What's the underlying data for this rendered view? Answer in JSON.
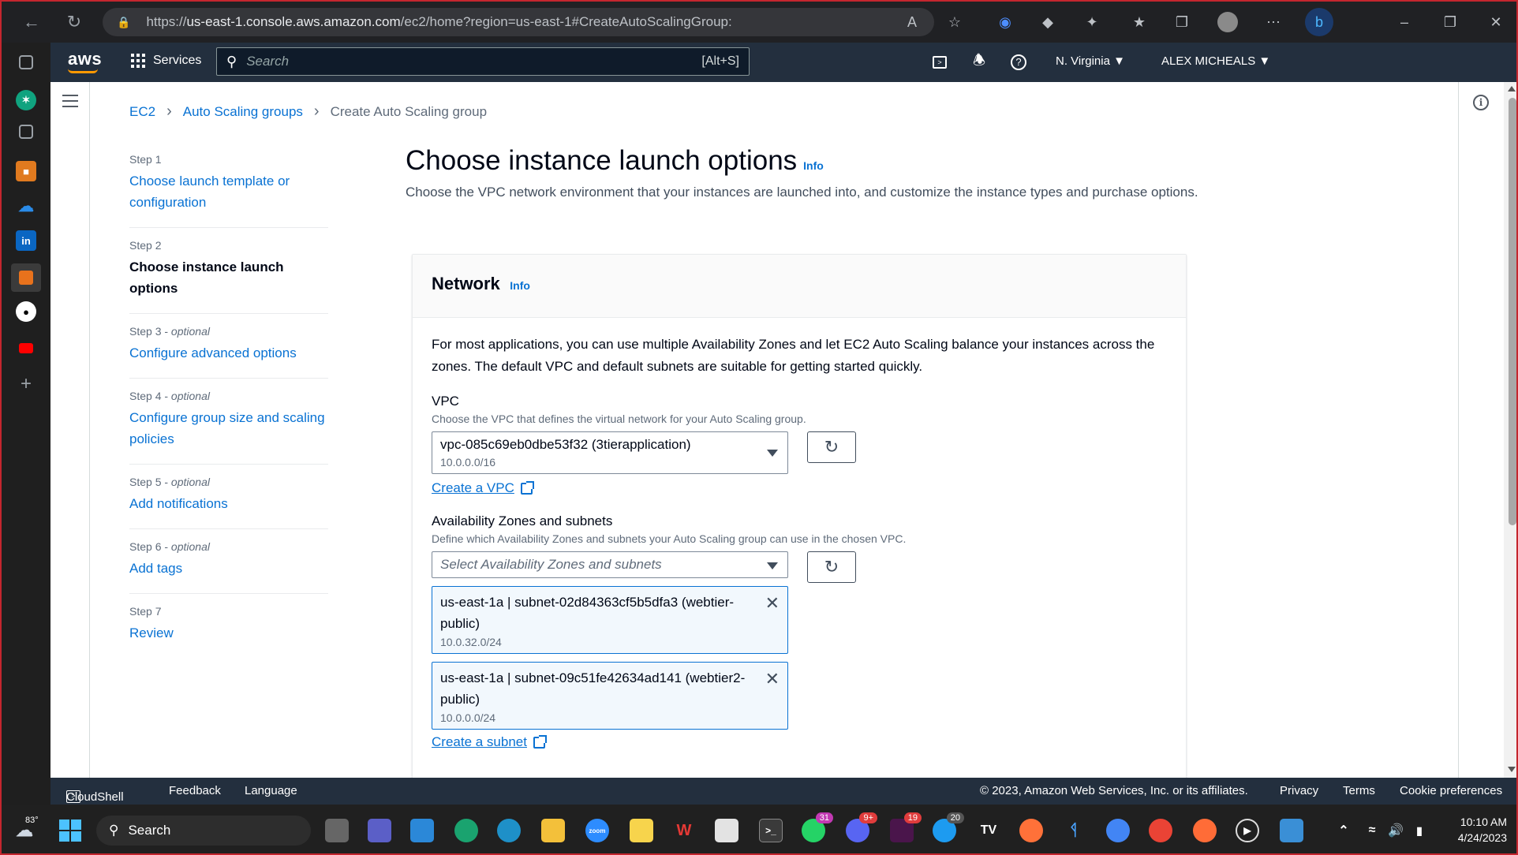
{
  "browser": {
    "url_prefix": "https://",
    "url_host": "us-east-1.console.aws.amazon.com",
    "url_rest": "/ec2/home?region=us-east-1#CreateAutoScalingGroup:"
  },
  "aws_nav": {
    "logo": "aws",
    "services": "Services",
    "search_placeholder": "Search",
    "search_shortcut": "[Alt+S]",
    "region": "N. Virginia",
    "user": "ALEX MICHEALS"
  },
  "breadcrumb": {
    "ec2": "EC2",
    "asg": "Auto Scaling groups",
    "current": "Create Auto Scaling group"
  },
  "steps": [
    {
      "num": "Step 1",
      "optional": "",
      "label": "Choose launch template or configuration"
    },
    {
      "num": "Step 2",
      "optional": "",
      "label": "Choose instance launch options"
    },
    {
      "num": "Step 3 - ",
      "optional": "optional",
      "label": "Configure advanced options"
    },
    {
      "num": "Step 4 - ",
      "optional": "optional",
      "label": "Configure group size and scaling policies"
    },
    {
      "num": "Step 5 - ",
      "optional": "optional",
      "label": "Add notifications"
    },
    {
      "num": "Step 6 - ",
      "optional": "optional",
      "label": "Add tags"
    },
    {
      "num": "Step 7",
      "optional": "",
      "label": "Review"
    }
  ],
  "page": {
    "title": "Choose instance launch options",
    "info": "Info",
    "description": "Choose the VPC network environment that your instances are launched into, and customize the instance types and purchase options."
  },
  "network": {
    "title": "Network",
    "info": "Info",
    "intro": "For most applications, you can use multiple Availability Zones and let EC2 Auto Scaling balance your instances across the zones. The default VPC and default subnets are suitable for getting started quickly.",
    "vpc_label": "VPC",
    "vpc_desc": "Choose the VPC that defines the virtual network for your Auto Scaling group.",
    "vpc_value": "vpc-085c69eb0dbe53f32 (3tierapplication)",
    "vpc_cidr": "10.0.0.0/16",
    "create_vpc": "Create a VPC",
    "az_label": "Availability Zones and subnets",
    "az_desc": "Define which Availability Zones and subnets your Auto Scaling group can use in the chosen VPC.",
    "az_placeholder": "Select Availability Zones and subnets",
    "subnets": [
      {
        "name": "us-east-1a | subnet-02d84363cf5b5dfa3 (webtier-public)",
        "cidr": "10.0.32.0/24"
      },
      {
        "name": "us-east-1a | subnet-09c51fe42634ad141 (webtier2-public)",
        "cidr": "10.0.0.0/24"
      }
    ],
    "create_subnet": "Create a subnet"
  },
  "footer": {
    "cloudshell": "CloudShell",
    "feedback": "Feedback",
    "language": "Language",
    "copyright": "© 2023, Amazon Web Services, Inc. or its affiliates.",
    "privacy": "Privacy",
    "terms": "Terms",
    "cookies": "Cookie preferences"
  },
  "taskbar": {
    "weather": "83°",
    "search": "Search",
    "badges": {
      "whatsapp": "31",
      "discord": "9+",
      "slack": "19",
      "twitter": "20"
    },
    "time": "10:10 AM",
    "date": "4/24/2023"
  },
  "colors": {
    "aws_nav": "#232f3e",
    "link": "#0972d3",
    "orange": "#ff9900",
    "frame": "#c4262e"
  }
}
